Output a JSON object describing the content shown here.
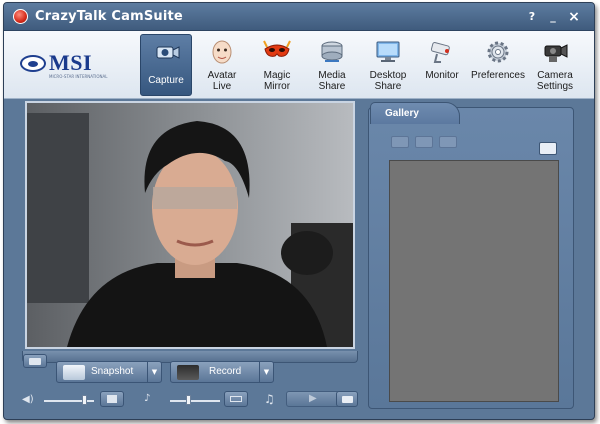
{
  "window": {
    "title": "CrazyTalk CamSuite",
    "controls": {
      "help": "?",
      "minimize": "_",
      "close": "×"
    }
  },
  "brand": {
    "name": "MSI",
    "subtitle": "MICRO-STAR INTERNATIONAL"
  },
  "toolbar": {
    "items": [
      {
        "label": "Capture",
        "icon": "camera-icon",
        "active": true
      },
      {
        "label": "Avatar\nLive",
        "icon": "avatar-face-icon"
      },
      {
        "label": "Magic\nMirror",
        "icon": "magic-mask-icon"
      },
      {
        "label": "Media\nShare",
        "icon": "media-share-icon"
      },
      {
        "label": "Desktop\nShare",
        "icon": "desktop-share-icon"
      },
      {
        "label": "Monitor",
        "icon": "security-camera-icon"
      },
      {
        "label": "Preferences",
        "icon": "gear-icon"
      },
      {
        "label": "Camera\nSettings",
        "icon": "camera-settings-icon"
      }
    ]
  },
  "capture": {
    "snapshot_label": "Snapshot",
    "record_label": "Record"
  },
  "gallery": {
    "title": "Gallery"
  },
  "colors": {
    "window_bg": "#5c7898",
    "titlebar": "#3f5b7d",
    "toolbar_bg": "#eef2f7",
    "gallery_area": "#747474"
  }
}
